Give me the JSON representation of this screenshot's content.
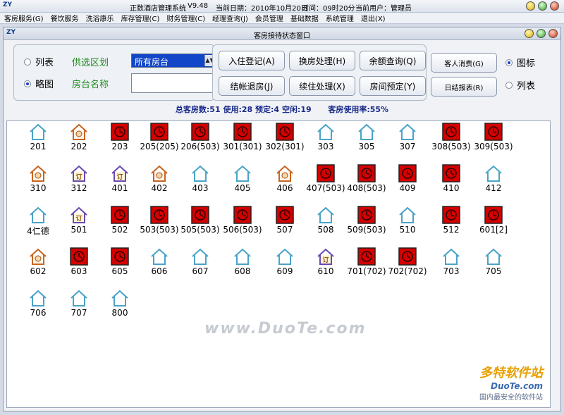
{
  "titlebar": {
    "icon": "ZY",
    "app_name": "正数酒店管理系统",
    "version": "V9.48",
    "date": "当前日期：2010年10月20日",
    "time": "时间：09时20分",
    "user": "当前用户：管理员"
  },
  "menu": [
    "客房服务(G)",
    "餐饮服务",
    "洗浴康乐",
    "库存管理(C)",
    "财务管理(C)",
    "经理查询(J)",
    "会员管理",
    "基础数据",
    "系统管理",
    "退出(X)"
  ],
  "subwindow": {
    "title": "客房接待状态窗口"
  },
  "view_mode": {
    "list": "列表",
    "thumb": "略图",
    "selected": "thumb"
  },
  "filter": {
    "area_label": "供选区划",
    "area_value": "所有房台",
    "name_label": "房台名称",
    "name_value": ""
  },
  "buttons": {
    "checkin": "入住登记(A)",
    "change_room": "换房处理(H)",
    "balance": "余额查询(Q)",
    "checkout": "结帐退房(J)",
    "extend": "续住处理(X)",
    "reserve": "房间预定(Y)",
    "guest_consume": "客人消费(G)",
    "daily_report": "日结报表(R)"
  },
  "display_mode": {
    "icon": "图标",
    "list": "列表",
    "selected": "icon"
  },
  "stats": {
    "total": "总客房数:51",
    "used": "使用:28",
    "reserved": "预定:4",
    "free": "空闲:19",
    "rate": "客房使用率:55%"
  },
  "status_colors": {
    "free": "#4aa3c8",
    "occupied": "#d40000",
    "dirty": "#c86420",
    "reserved": "#6a4ab0"
  },
  "rooms": [
    {
      "num": "201",
      "status": "free"
    },
    {
      "num": "202",
      "status": "dirty"
    },
    {
      "num": "203",
      "status": "occupied"
    },
    {
      "num": "205(205)",
      "status": "occupied"
    },
    {
      "num": "206(503)",
      "status": "occupied"
    },
    {
      "num": "301(301)",
      "status": "occupied"
    },
    {
      "num": "302(301)",
      "status": "occupied"
    },
    {
      "num": "303",
      "status": "free"
    },
    {
      "num": "305",
      "status": "free"
    },
    {
      "num": "307",
      "status": "free"
    },
    {
      "num": "308(503)",
      "status": "occupied"
    },
    {
      "num": "309(503)",
      "status": "occupied"
    },
    {
      "num": "310",
      "status": "dirty"
    },
    {
      "num": "312",
      "status": "reserved"
    },
    {
      "num": "401",
      "status": "reserved"
    },
    {
      "num": "402",
      "status": "dirty"
    },
    {
      "num": "403",
      "status": "free"
    },
    {
      "num": "405",
      "status": "free"
    },
    {
      "num": "406",
      "status": "dirty"
    },
    {
      "num": "407(503)",
      "status": "occupied"
    },
    {
      "num": "408(503)",
      "status": "occupied"
    },
    {
      "num": "409",
      "status": "occupied"
    },
    {
      "num": "410",
      "status": "occupied"
    },
    {
      "num": "412",
      "status": "free"
    },
    {
      "num": "4仁德",
      "status": "free"
    },
    {
      "num": "501",
      "status": "reserved"
    },
    {
      "num": "502",
      "status": "occupied"
    },
    {
      "num": "503(503)",
      "status": "occupied"
    },
    {
      "num": "505(503)",
      "status": "occupied"
    },
    {
      "num": "506(503)",
      "status": "occupied"
    },
    {
      "num": "507",
      "status": "occupied"
    },
    {
      "num": "508",
      "status": "free"
    },
    {
      "num": "509(503)",
      "status": "occupied"
    },
    {
      "num": "510",
      "status": "free"
    },
    {
      "num": "512",
      "status": "occupied"
    },
    {
      "num": "601[2]",
      "status": "occupied"
    },
    {
      "num": "602",
      "status": "dirty"
    },
    {
      "num": "603",
      "status": "occupied"
    },
    {
      "num": "605",
      "status": "occupied"
    },
    {
      "num": "606",
      "status": "free"
    },
    {
      "num": "607",
      "status": "free"
    },
    {
      "num": "608",
      "status": "free"
    },
    {
      "num": "609",
      "status": "free"
    },
    {
      "num": "610",
      "status": "reserved"
    },
    {
      "num": "701(702)",
      "status": "occupied"
    },
    {
      "num": "702(702)",
      "status": "occupied"
    },
    {
      "num": "703",
      "status": "free"
    },
    {
      "num": "705",
      "status": "free"
    },
    {
      "num": "706",
      "status": "free"
    },
    {
      "num": "707",
      "status": "free"
    },
    {
      "num": "800",
      "status": "free"
    }
  ],
  "watermark": {
    "center": "www.DuoTe.com",
    "corner_1": "多特软件站",
    "corner_2": "DuoTe.com",
    "corner_3": "国内最安全的软件站"
  }
}
